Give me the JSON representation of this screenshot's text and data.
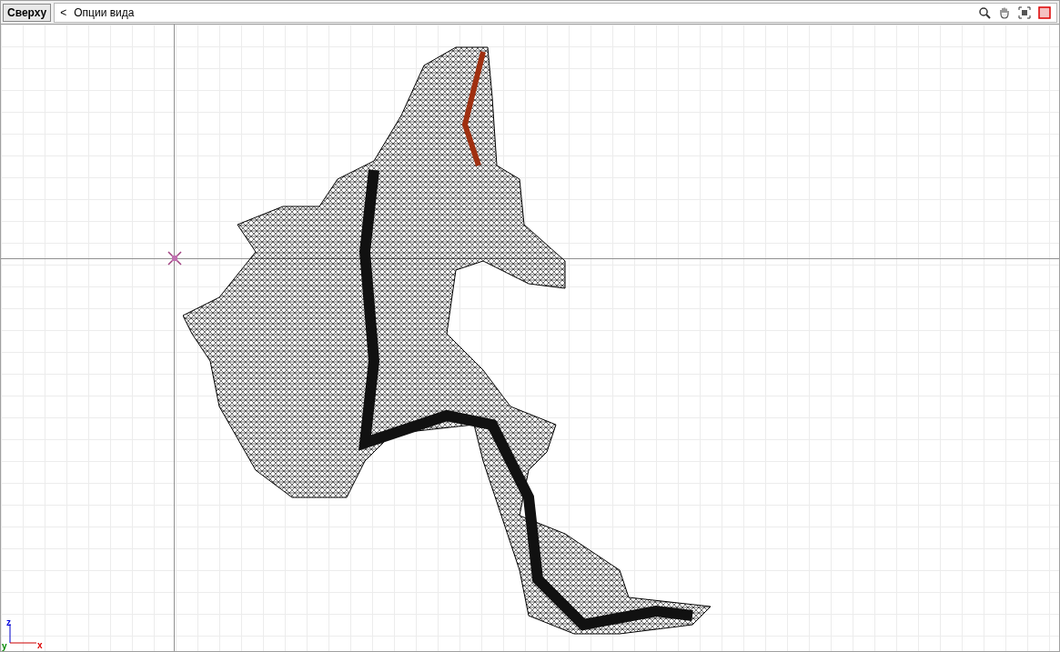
{
  "toolbar": {
    "view_label": "Сверху",
    "back": "<",
    "options_title": "Опции вида"
  },
  "axes": {
    "z": "z",
    "x": "x",
    "y": "y"
  }
}
